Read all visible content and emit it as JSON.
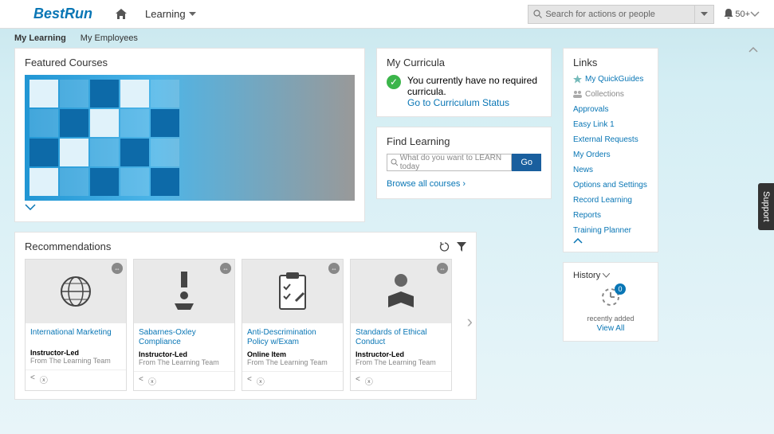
{
  "header": {
    "brand": "BestRun",
    "nav_label": "Learning",
    "search_placeholder": "Search for actions or people",
    "notif_count": "50+"
  },
  "subnav": {
    "tab1": "My Learning",
    "tab2": "My Employees"
  },
  "featured": {
    "title": "Featured Courses"
  },
  "recommendations": {
    "title": "Recommendations",
    "cards": [
      {
        "title": "International Marketing",
        "type": "Instructor-Led",
        "sub": "From The Learning Team"
      },
      {
        "title": "Sabarnes-Oxley Compliance",
        "type": "Instructor-Led",
        "sub": "From The Learning Team"
      },
      {
        "title": "Anti-Descrimination Policy w/Exam",
        "type": "Online Item",
        "sub": "From The Learning Team"
      },
      {
        "title": "Standards of Ethical Conduct",
        "type": "Instructor-Led",
        "sub": "From The Learning Team"
      }
    ]
  },
  "curricula": {
    "title": "My Curricula",
    "message": "You currently have no required curricula.",
    "link": "Go to Curriculum Status"
  },
  "find": {
    "title": "Find Learning",
    "placeholder": "What do you want to LEARN today",
    "go": "Go",
    "browse": "Browse all courses"
  },
  "links": {
    "title": "Links",
    "quickguides": "My QuickGuides",
    "collections": "Collections",
    "items": [
      "Approvals",
      "Easy Link 1",
      "External Requests",
      "My Orders",
      "News",
      "Options and Settings",
      "Record Learning",
      "Reports",
      "Training Planner"
    ]
  },
  "history": {
    "title": "History",
    "badge": "0",
    "sub": "recently added",
    "viewall": "View All"
  },
  "support": "Support"
}
